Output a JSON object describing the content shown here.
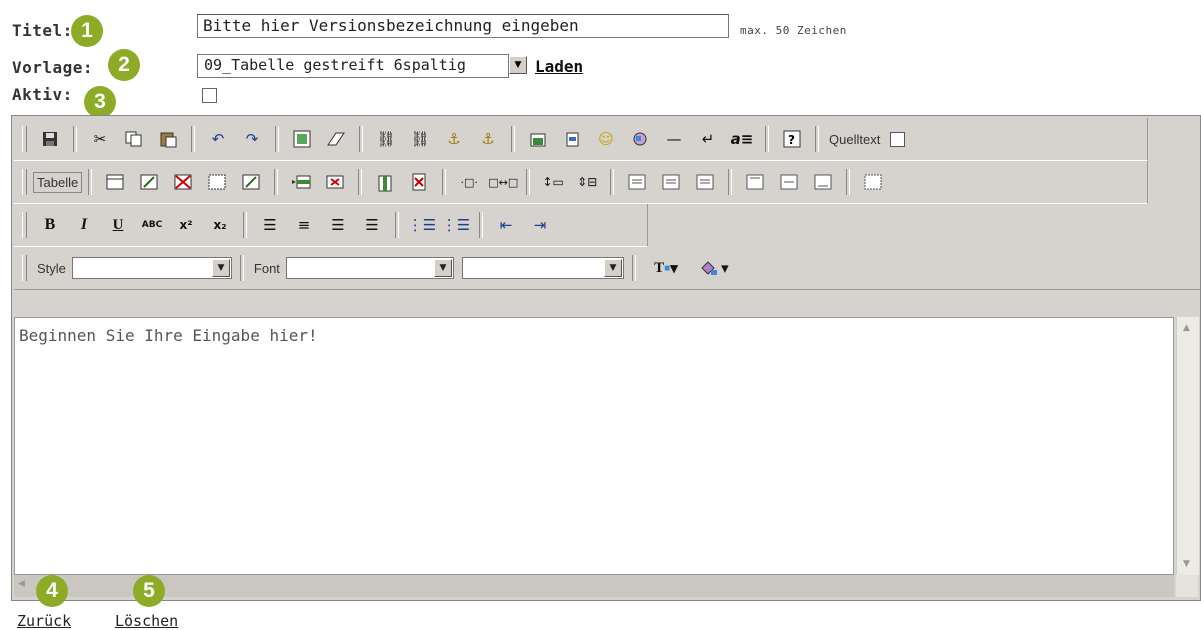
{
  "form": {
    "titel_label": "Titel:",
    "vorlage_label": "Vorlage:",
    "aktiv_label": "Aktiv:",
    "titel_value": "Bitte hier Versionsbezeichnung eingeben",
    "titel_hint": "max. 50 Zeichen",
    "vorlage_selected": "09_Tabelle gestreift 6spaltig",
    "laden_label": "Laden",
    "aktiv_checked": false
  },
  "badges": [
    "1",
    "2",
    "3",
    "4",
    "5"
  ],
  "toolbar": {
    "row1": {
      "icons": [
        "save-icon",
        "cut-icon",
        "copy-icon",
        "paste-icon",
        "undo-icon",
        "redo-icon",
        "select-all-icon",
        "eraser-icon",
        "link-icon",
        "unlink-icon",
        "anchor-icon",
        "anchor-list-icon",
        "insert-image-icon",
        "insert-document-icon",
        "smiley-icon",
        "insert-object-icon",
        "horizontal-rule-icon",
        "line-break-icon",
        "format-text-icon",
        "help-icon"
      ],
      "quelltext_label": "Quelltext"
    },
    "row2": {
      "tabelle_label": "Tabelle",
      "icons": [
        "insert-table-icon",
        "table-properties-icon",
        "delete-table-icon",
        "table-borders-icon",
        "cell-properties-icon",
        "insert-row-icon",
        "delete-row-icon",
        "insert-column-icon",
        "delete-column-icon",
        "insert-cell-icon",
        "merge-cells-icon",
        "split-row-icon",
        "split-column-icon",
        "align-top-left-icon",
        "align-top-center-icon",
        "align-top-right-icon",
        "valign-top-icon",
        "valign-middle-icon",
        "valign-bottom-icon",
        "cell-frame-icon"
      ]
    },
    "row3": {
      "bold": "B",
      "italic": "I",
      "underline": "U",
      "strike": "ABC",
      "superscript": "x²",
      "subscript": "x₂",
      "icons": [
        "align-left-icon",
        "align-center-icon",
        "align-right-icon",
        "justify-icon",
        "ordered-list-icon",
        "unordered-list-icon",
        "outdent-icon",
        "indent-icon"
      ]
    },
    "row4": {
      "style_label": "Style",
      "style_value": "",
      "font_label": "Font",
      "font_value": "",
      "size_value": "",
      "icons": [
        "text-color-icon",
        "background-color-icon"
      ]
    }
  },
  "editor": {
    "placeholder_text": "Beginnen Sie Ihre Eingabe hier!"
  },
  "footer": {
    "zurueck_label": "Zurück",
    "loeschen_label": "Löschen"
  }
}
